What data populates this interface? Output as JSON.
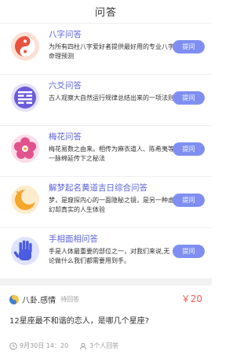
{
  "header": {
    "title": "问答"
  },
  "items": [
    {
      "title": "八字问答",
      "desc": "为所有四柱八字爱好者提供最好用的专业八字命理预测",
      "button": "提问",
      "icon": "yin-yang-icon",
      "color": "#e8523f"
    },
    {
      "title": "六爻问答",
      "desc": "古人观察大自然运行规律总结出来的一项法则",
      "button": "提问",
      "icon": "hexagram-icon",
      "color": "#6a5cd9"
    },
    {
      "title": "梅花问答",
      "desc": "梅花易数之由来。相传为麻衣道人、陈希夷等一脉绵延传下之秘法",
      "button": "提问",
      "icon": "plum-blossom-icon",
      "color": "#e2528c"
    },
    {
      "title": "解梦起名黄道吉日综合问答",
      "desc": "梦，是窥探内心的一面隐秘之镜，是另一种虚幻却真实的人生体验",
      "button": "提问",
      "icon": "dream-moon-icon",
      "color": "#f3a62a"
    },
    {
      "title": "手相面相问答",
      "desc": "手是人体最重要的部位之一，对我们来说,无论做什么我们都需要用到手。",
      "button": "提问",
      "icon": "palm-icon",
      "color": "#4b5ce0"
    }
  ],
  "question": {
    "category": "八卦.感情",
    "status": "待回答",
    "price": "￥20",
    "text": "12星座最不和谐的恋人，是哪几个星座?",
    "time": "9月30日 14：20",
    "answers": "3个人回答"
  },
  "colors": {
    "accent": "#7f8ff1",
    "title": "#5b63d8",
    "price": "#f45b55"
  }
}
